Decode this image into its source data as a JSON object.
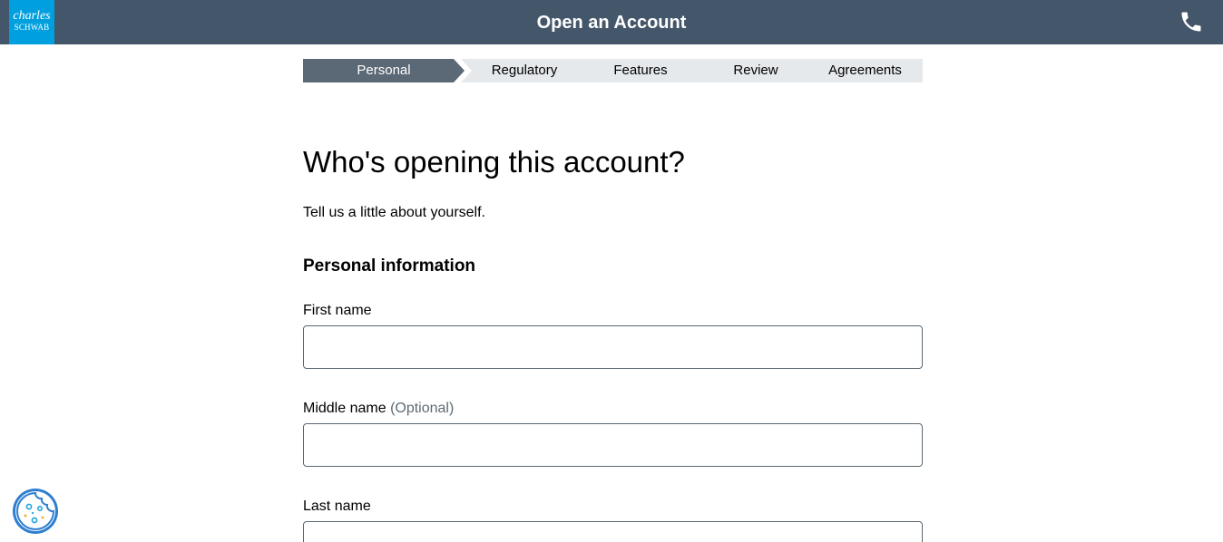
{
  "header": {
    "logo_line1": "charles",
    "logo_line2": "SCHWAB",
    "title": "Open an Account",
    "phone_icon": "phone-icon"
  },
  "steps": [
    {
      "label": "Personal",
      "active": true
    },
    {
      "label": "Regulatory",
      "active": false
    },
    {
      "label": "Features",
      "active": false
    },
    {
      "label": "Review",
      "active": false
    },
    {
      "label": "Agreements",
      "active": false
    }
  ],
  "main": {
    "heading": "Who's opening this account?",
    "subheading": "Tell us a little about yourself.",
    "section_title": "Personal information",
    "fields": {
      "first_name": {
        "label": "First name",
        "value": ""
      },
      "middle_name": {
        "label": "Middle name",
        "optional": "(Optional)",
        "value": ""
      },
      "last_name": {
        "label": "Last name",
        "value": ""
      }
    }
  },
  "cookie_icon": "cookie-icon",
  "colors": {
    "header_bg": "#44566a",
    "logo_bg": "#00a0df",
    "step_active": "#5b6875",
    "step_inactive": "#e6e9ec",
    "input_border": "#5b6670"
  }
}
